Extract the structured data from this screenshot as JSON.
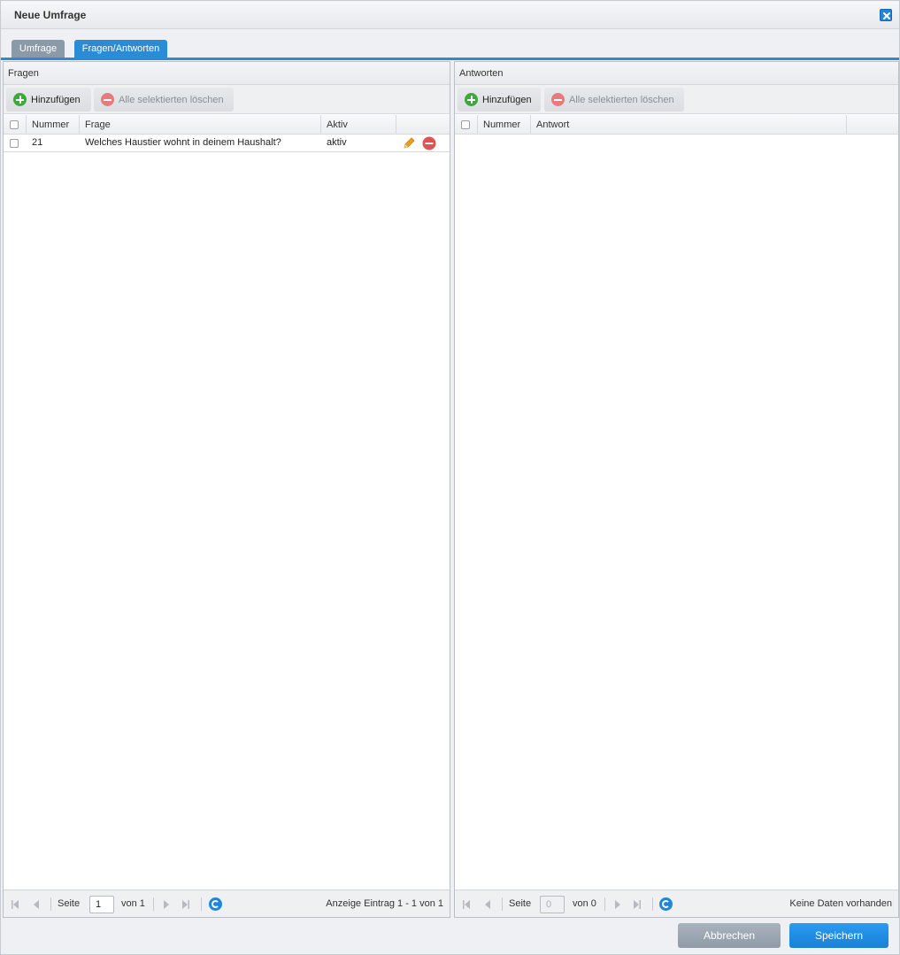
{
  "window": {
    "title": "Neue Umfrage"
  },
  "tabs": [
    {
      "label": "Umfrage",
      "active": false
    },
    {
      "label": "Fragen/Antworten",
      "active": true
    }
  ],
  "fragen": {
    "header": "Fragen",
    "add_label": "Hinzufügen",
    "delete_label": "Alle selektierten löschen",
    "columns": {
      "nummer": "Nummer",
      "frage": "Frage",
      "aktiv": "Aktiv"
    },
    "rows": [
      {
        "nummer": "21",
        "frage": "Welches Haustier wohnt in deinem Haushalt?",
        "aktiv": "aktiv"
      }
    ],
    "pager": {
      "seite_label": "Seite",
      "page": "1",
      "von_label": "von 1",
      "status": "Anzeige Eintrag 1 - 1 von 1"
    }
  },
  "antworten": {
    "header": "Antworten",
    "add_label": "Hinzufügen",
    "delete_label": "Alle selektierten löschen",
    "columns": {
      "nummer": "Nummer",
      "antwort": "Antwort"
    },
    "pager": {
      "seite_label": "Seite",
      "page": "0",
      "von_label": "von 0",
      "status": "Keine Daten vorhanden"
    }
  },
  "footer": {
    "cancel_label": "Abbrechen",
    "save_label": "Speichern"
  },
  "colors": {
    "accent": "#2a8bd6",
    "add": "#3ea83a",
    "delete": "#e05353",
    "edit": "#f0a020"
  },
  "icons": [
    "close-icon",
    "add-icon",
    "delete-icon",
    "edit-icon",
    "remove-icon",
    "first-page-icon",
    "prev-page-icon",
    "next-page-icon",
    "last-page-icon",
    "refresh-icon"
  ]
}
